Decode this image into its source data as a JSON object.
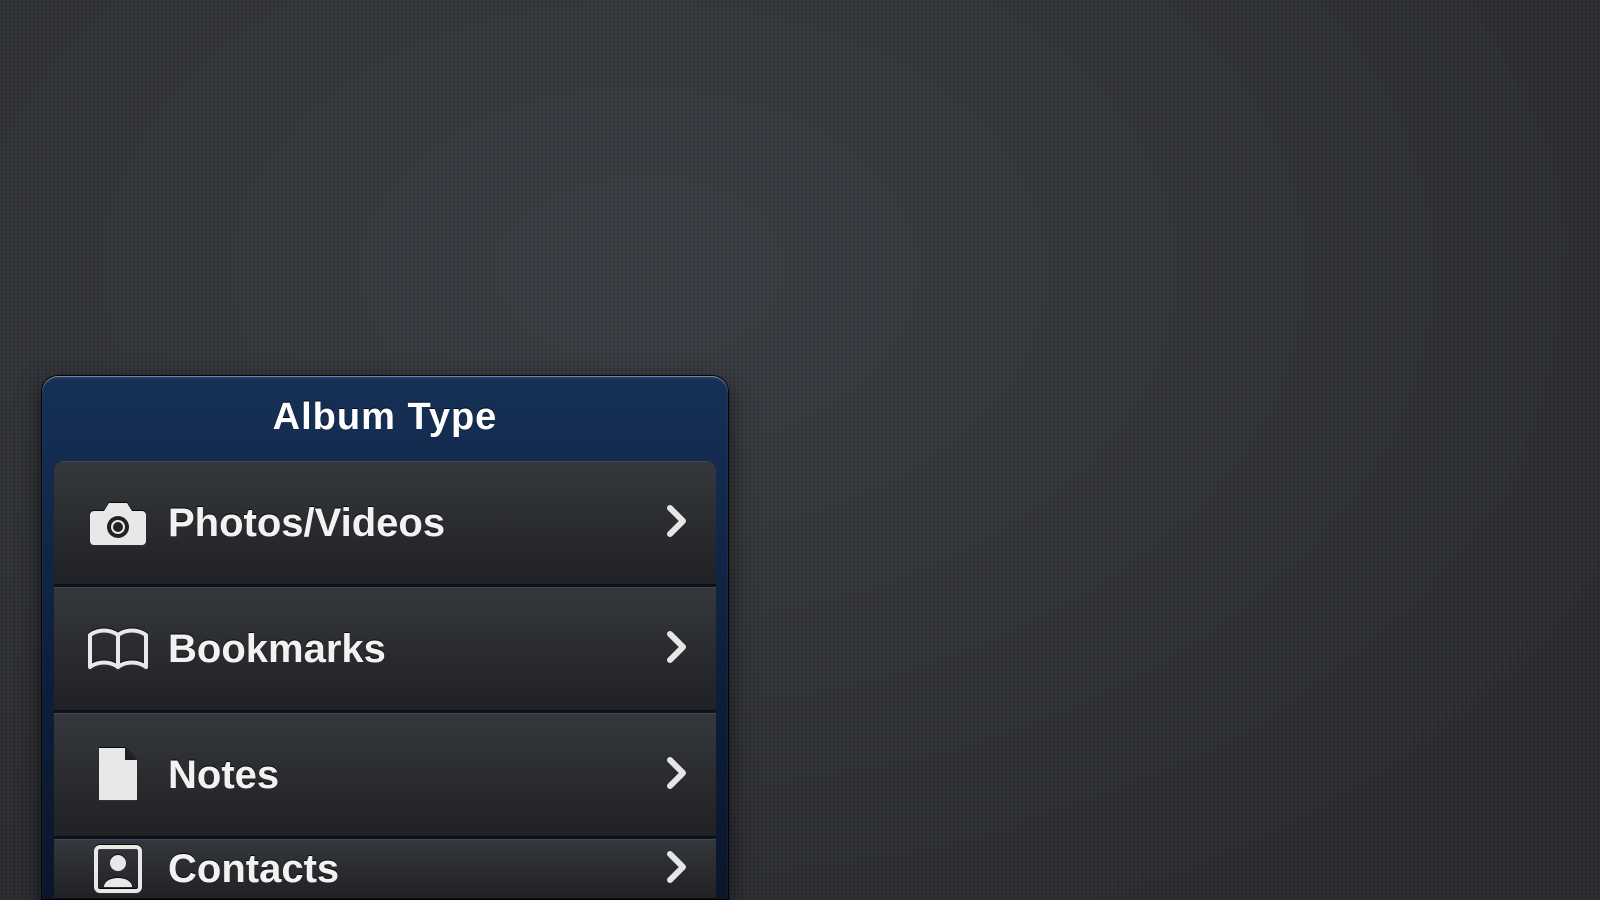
{
  "popover": {
    "title": "Album Type",
    "items": [
      {
        "label": "Photos/Videos",
        "icon": "camera-icon"
      },
      {
        "label": "Bookmarks",
        "icon": "book-icon"
      },
      {
        "label": "Notes",
        "icon": "document-icon"
      },
      {
        "label": "Contacts",
        "icon": "contact-icon"
      }
    ]
  }
}
